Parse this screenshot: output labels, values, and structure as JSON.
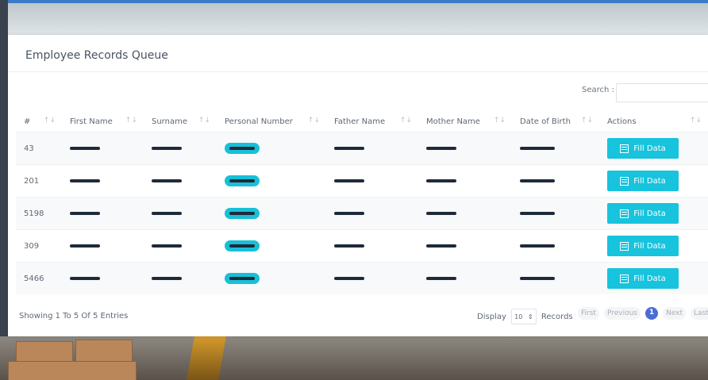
{
  "panel": {
    "title": "Employee Records Queue"
  },
  "search": {
    "label": "Search :",
    "placeholder": ""
  },
  "table": {
    "headers": [
      "#",
      "First Name",
      "Surname",
      "Personal Number",
      "Father Name",
      "Mother Name",
      "Date of Birth",
      "Actions"
    ],
    "rows": [
      {
        "id": "43"
      },
      {
        "id": "201"
      },
      {
        "id": "5198"
      },
      {
        "id": "309"
      },
      {
        "id": "5466"
      }
    ],
    "action_label": "Fill Data",
    "sort_icon": "↑↓"
  },
  "footer": {
    "info": "Showing 1 To 5 Of 5 Entries",
    "display_label": "Display",
    "records_label": "Records",
    "page_size": "10",
    "select_icon": "⇕"
  },
  "pagination": {
    "first": "First",
    "previous": "Previous",
    "current": "1",
    "next": "Next",
    "last": "Last"
  },
  "colors": {
    "accent": "#17c3dd",
    "active_page": "#4b6dd6",
    "header_bar": "#3c7cc7"
  }
}
